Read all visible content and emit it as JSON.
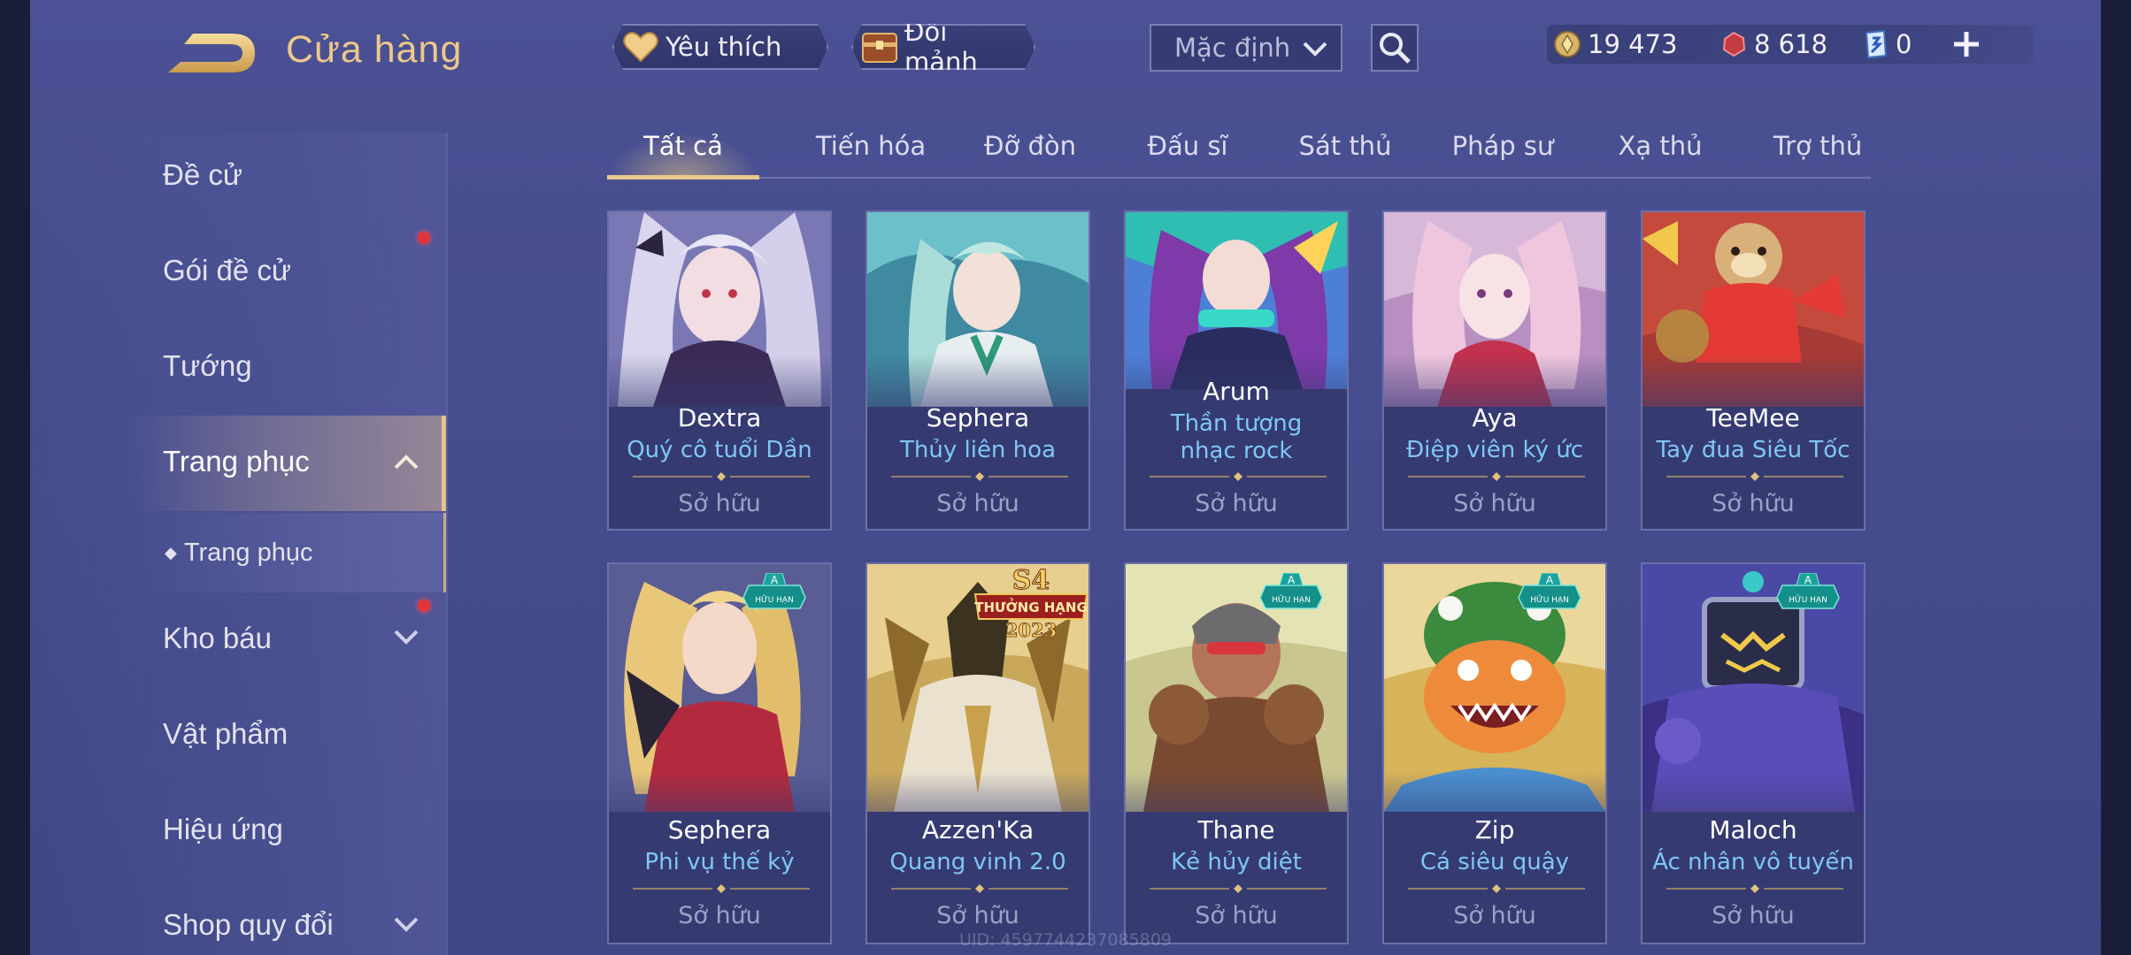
{
  "header": {
    "title": "Cửa hàng",
    "favorites_label": "Yêu thích",
    "exchange_label": "Đổi mảnh",
    "sort_value": "Mặc định"
  },
  "currency": {
    "gold": "19 473",
    "gems": "8 618",
    "vouchers": "0"
  },
  "sidebar": {
    "items": [
      {
        "label": "Đề cử"
      },
      {
        "label": "Gói đề cử"
      },
      {
        "label": "Tướng"
      },
      {
        "label": "Trang phục"
      },
      {
        "label": "Trang phục"
      },
      {
        "label": "Kho báu"
      },
      {
        "label": "Vật phẩm"
      },
      {
        "label": "Hiệu ứng"
      },
      {
        "label": "Shop quy đổi"
      }
    ]
  },
  "tabs": [
    "Tất cả",
    "Tiến hóa",
    "Đỡ đòn",
    "Đấu sĩ",
    "Sát thủ",
    "Pháp sư",
    "Xạ thủ",
    "Trợ thủ"
  ],
  "cards": [
    {
      "hero": "Dextra",
      "skin": "Quý cô tuổi Dần",
      "status": "Sở hữu"
    },
    {
      "hero": "Sephera",
      "skin": "Thủy liên hoa",
      "status": "Sở hữu"
    },
    {
      "hero": "Arum",
      "skin": "Thần tượng nhạc rock",
      "status": "Sở hữu"
    },
    {
      "hero": "Aya",
      "skin": "Điệp viên ký ức",
      "status": "Sở hữu"
    },
    {
      "hero": "TeeMee",
      "skin": "Tay đua Siêu Tốc",
      "status": "Sở hữu"
    },
    {
      "hero": "Sephera",
      "skin": "Phi vụ thế kỷ",
      "status": "Sở hữu",
      "badge_grade": "A",
      "badge_text": "HỮU HẠN"
    },
    {
      "hero": "Azzen'Ka",
      "skin": "Quang vinh 2.0",
      "status": "Sở hữu",
      "banner_top": "S4",
      "banner_mid": "THƯỞNG HẠNG",
      "banner_year": "2023"
    },
    {
      "hero": "Thane",
      "skin": "Kẻ hủy diệt",
      "status": "Sở hữu",
      "badge_grade": "A",
      "badge_text": "HỮU HẠN"
    },
    {
      "hero": "Zip",
      "skin": "Cá siêu quậy",
      "status": "Sở hữu",
      "badge_grade": "A",
      "badge_text": "HỮU HẠN"
    },
    {
      "hero": "Maloch",
      "skin": "Ác nhân vô tuyến",
      "status": "Sở hữu",
      "badge_grade": "A",
      "badge_text": "HỮU HẠN"
    }
  ],
  "footer": {
    "uid": "UID: 4597744237085809"
  },
  "colors": {
    "title_gold": "#ecc98a",
    "skin_blue": "#7fc7f5",
    "owned_grey": "#9da1c6",
    "notification_red": "#e0343c"
  }
}
